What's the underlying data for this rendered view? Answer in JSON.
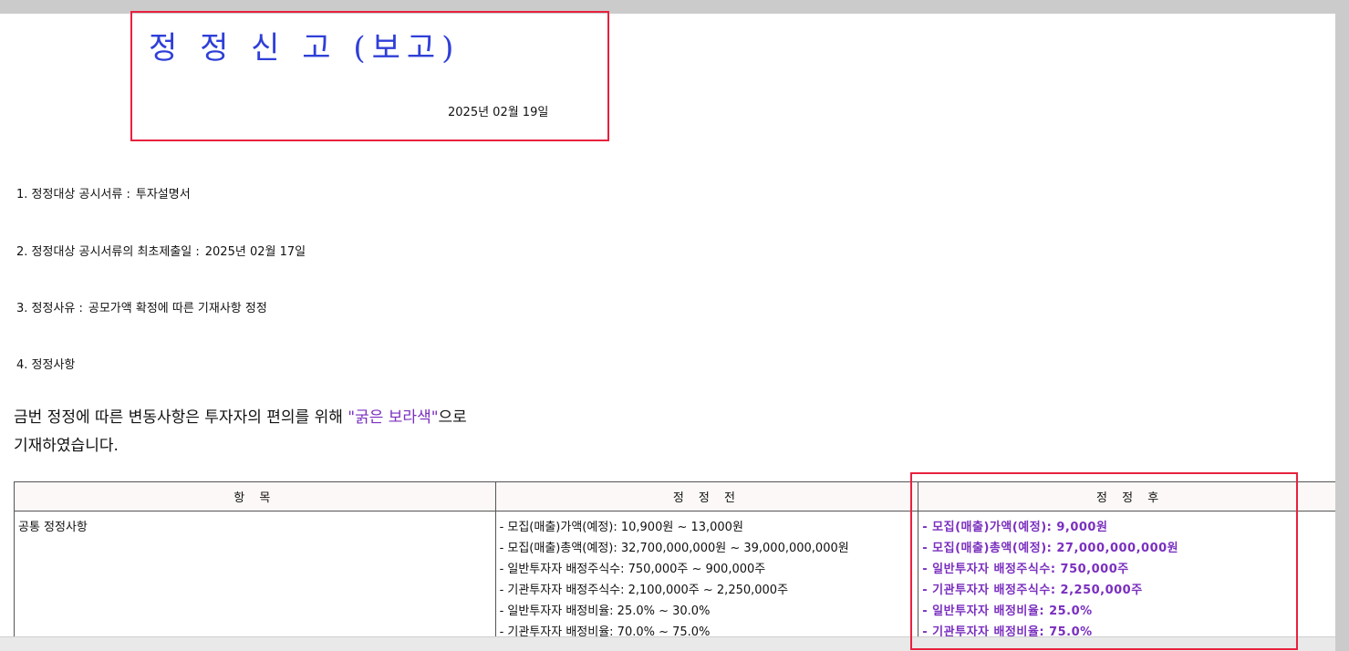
{
  "document": {
    "title": "정 정 신 고 (보고)",
    "date": "2025년 02월 19일"
  },
  "items": [
    {
      "label": "1. 정정대상 공시서류 :",
      "value": "투자설명서"
    },
    {
      "label": "2. 정정대상 공시서류의 최초제출일 :",
      "value": "2025년 02월 17일"
    },
    {
      "label": "3. 정정사유 :",
      "value": "공모가액 확정에 따른 기재사항 정정"
    },
    {
      "label": "4. 정정사항",
      "value": ""
    }
  ],
  "notice": {
    "part1": "금번 정정에 따른 변동사항은 투자자의 편의를 위해 ",
    "highlight": "\"굵은 보라색\"",
    "part2": "으로",
    "line2": "기재하였습니다."
  },
  "table": {
    "headers": [
      "항 목",
      "정 정 전",
      "정 정 후"
    ],
    "row": {
      "item": "공통 정정사항",
      "before": [
        "- 모집(매출)가액(예정): 10,900원 ~ 13,000원",
        "- 모집(매출)총액(예정): 32,700,000,000원 ~ 39,000,000,000원",
        "- 일반투자자 배정주식수: 750,000주 ~ 900,000주",
        "- 기관투자자 배정주식수: 2,100,000주 ~ 2,250,000주",
        "- 일반투자자 배정비율: 25.0% ~ 30.0%",
        "- 기관투자자 배정비율: 70.0% ~ 75.0%"
      ],
      "after": [
        "- 모집(매출)가액(예정): 9,000원",
        "- 모집(매출)총액(예정): 27,000,000,000원",
        "- 일반투자자 배정주식수: 750,000주",
        "- 기관투자자 배정주식수: 2,250,000주",
        "- 일반투자자 배정비율: 25.0%",
        "- 기관투자자 배정비율: 75.0%"
      ]
    }
  },
  "colors": {
    "title": "#2f3fd8",
    "highlight": "#7a2fbf",
    "annotation_box": "#e8213e"
  }
}
